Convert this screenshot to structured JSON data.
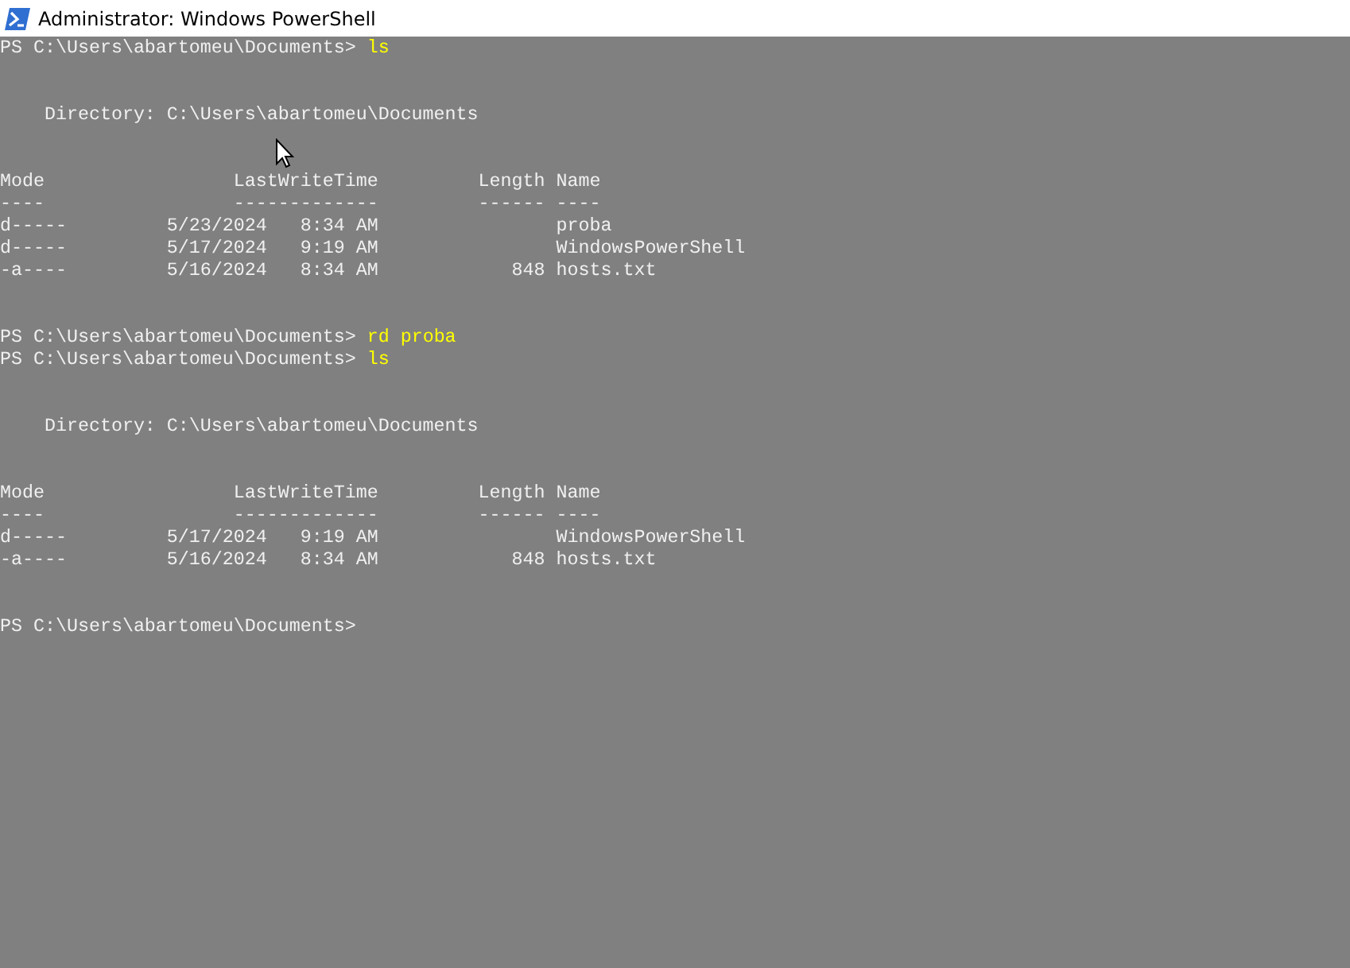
{
  "window": {
    "title": "Administrator: Windows PowerShell"
  },
  "console": {
    "lines": [
      {
        "kind": "prompt",
        "prompt": "PS C:\\Users\\abartomeu\\Documents> ",
        "command": "ls"
      },
      {
        "kind": "blank"
      },
      {
        "kind": "blank"
      },
      {
        "kind": "text",
        "text": "    Directory: C:\\Users\\abartomeu\\Documents"
      },
      {
        "kind": "blank"
      },
      {
        "kind": "blank"
      },
      {
        "kind": "text",
        "text": "Mode                 LastWriteTime         Length Name"
      },
      {
        "kind": "text",
        "text": "----                 -------------         ------ ----"
      },
      {
        "kind": "text",
        "text": "d-----         5/23/2024   8:34 AM                proba"
      },
      {
        "kind": "text",
        "text": "d-----         5/17/2024   9:19 AM                WindowsPowerShell"
      },
      {
        "kind": "text",
        "text": "-a----         5/16/2024   8:34 AM            848 hosts.txt"
      },
      {
        "kind": "blank"
      },
      {
        "kind": "blank"
      },
      {
        "kind": "prompt",
        "prompt": "PS C:\\Users\\abartomeu\\Documents> ",
        "command": "rd proba"
      },
      {
        "kind": "prompt",
        "prompt": "PS C:\\Users\\abartomeu\\Documents> ",
        "command": "ls"
      },
      {
        "kind": "blank"
      },
      {
        "kind": "blank"
      },
      {
        "kind": "text",
        "text": "    Directory: C:\\Users\\abartomeu\\Documents"
      },
      {
        "kind": "blank"
      },
      {
        "kind": "blank"
      },
      {
        "kind": "text",
        "text": "Mode                 LastWriteTime         Length Name"
      },
      {
        "kind": "text",
        "text": "----                 -------------         ------ ----"
      },
      {
        "kind": "text",
        "text": "d-----         5/17/2024   9:19 AM                WindowsPowerShell"
      },
      {
        "kind": "text",
        "text": "-a----         5/16/2024   8:34 AM            848 hosts.txt"
      },
      {
        "kind": "blank"
      },
      {
        "kind": "blank"
      },
      {
        "kind": "prompt",
        "prompt": "PS C:\\Users\\abartomeu\\Documents>"
      }
    ]
  }
}
